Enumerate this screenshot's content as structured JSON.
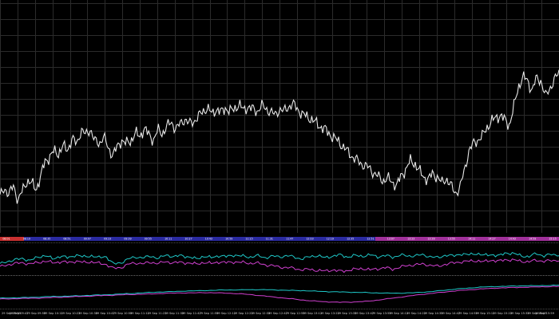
{
  "chart_data": {
    "type": "line",
    "title": "",
    "xlabel": "",
    "ylabel": "",
    "grid": true,
    "background": "#000000",
    "grid_color": "#2b2b2b",
    "price_series": {
      "name": "",
      "color": "#e8e8e8",
      "level_scale": [
        0,
        100
      ],
      "values": [
        15,
        22,
        17,
        24,
        12,
        20,
        28,
        26,
        21,
        31,
        44,
        47,
        52,
        50,
        56,
        53,
        62,
        58,
        69,
        65,
        70,
        60,
        58,
        64,
        54,
        49,
        55,
        61,
        58,
        60,
        67,
        63,
        71,
        65,
        61,
        69,
        66,
        72,
        75,
        70,
        74,
        78,
        74,
        76,
        80,
        84,
        87,
        82,
        86,
        83,
        87,
        84,
        86,
        90,
        85,
        88,
        86,
        84,
        89,
        86,
        84,
        81,
        86,
        84,
        88,
        90,
        86,
        82,
        80,
        78,
        75,
        72,
        70,
        66,
        63,
        60,
        56,
        52,
        48,
        45,
        42,
        40,
        38,
        34,
        31,
        28,
        30,
        27,
        24,
        32,
        37,
        44,
        42,
        36,
        31,
        29,
        34,
        31,
        26,
        30,
        24,
        18,
        22,
        36,
        52,
        58,
        61,
        64,
        71,
        76,
        79,
        81,
        77,
        73,
        88,
        104,
        112,
        109,
        101,
        111,
        109,
        96,
        103,
        110,
        115
      ]
    },
    "indicator1_series": [
      {
        "name": "",
        "color": "#1ec8c8",
        "values": [
          30,
          40,
          45,
          50,
          42,
          55,
          60,
          48,
          58,
          52,
          62,
          55,
          60,
          52,
          58,
          30,
          35,
          48,
          55,
          52,
          58,
          50,
          62,
          56,
          60,
          55,
          48,
          58,
          52,
          60,
          56,
          62,
          58,
          54,
          60,
          52,
          58,
          55,
          60,
          54,
          48,
          56,
          60,
          52,
          58,
          62,
          55,
          60,
          58,
          62,
          56,
          60,
          54,
          62,
          58,
          60,
          62,
          56,
          52,
          62,
          58,
          66,
          62,
          68,
          60,
          64,
          58,
          70,
          66,
          60,
          55,
          68,
          58,
          64,
          62
        ]
      },
      {
        "name": "",
        "color": "#d040d0",
        "values": [
          20,
          28,
          32,
          35,
          30,
          36,
          40,
          35,
          38,
          36,
          40,
          36,
          38,
          33,
          30,
          15,
          18,
          30,
          34,
          32,
          36,
          33,
          38,
          35,
          36,
          34,
          30,
          36,
          32,
          38,
          35,
          38,
          36,
          33,
          34,
          28,
          25,
          20,
          18,
          15,
          10,
          12,
          8,
          6,
          10,
          5,
          8,
          12,
          15,
          10,
          14,
          18,
          12,
          20,
          25,
          28,
          30,
          26,
          22,
          30,
          34,
          38,
          40,
          42,
          38,
          44,
          40,
          46,
          44,
          40,
          38,
          44,
          40,
          42,
          44
        ]
      }
    ],
    "indicator2_series": [
      {
        "name": "",
        "color": "#1ec8c8",
        "values": [
          30,
          31,
          32,
          33,
          35,
          36,
          37,
          38,
          40,
          41,
          43,
          45,
          47,
          49,
          51,
          52,
          54,
          55,
          56,
          57,
          58,
          58,
          59,
          59,
          58,
          57,
          56,
          55,
          53,
          52,
          51,
          50,
          49,
          48,
          47,
          47,
          48,
          50,
          53,
          57,
          61,
          64,
          67,
          69,
          70,
          71,
          72,
          72,
          73,
          74
        ]
      },
      {
        "name": "",
        "color": "#d040d0",
        "values": [
          27,
          28,
          29,
          30,
          31,
          33,
          34,
          36,
          37,
          39,
          40,
          42,
          43,
          44,
          46,
          47,
          48,
          48,
          49,
          48,
          47,
          45,
          42,
          38,
          34,
          30,
          26,
          22,
          19,
          17,
          16,
          17,
          19,
          23,
          28,
          33,
          38,
          43,
          47,
          51,
          55,
          58,
          61,
          63,
          65,
          66,
          67,
          68,
          69,
          70
        ]
      }
    ],
    "band": {
      "segment_colors": [
        "#c83030",
        "#2a2aa0",
        "#a0309a"
      ],
      "labels": [
        "08:01",
        "08:19",
        "08:35",
        "08:51",
        "09:07",
        "09:23",
        "09:39",
        "09:55",
        "10:11",
        "10:27",
        "10:43",
        "10:59",
        "11:15",
        "11:31",
        "11:47",
        "12:03",
        "12:19",
        "12:35",
        "12:51",
        "13:07",
        "13:23",
        "13:39",
        "13:55",
        "14:11",
        "14:27",
        "14:43",
        "14:59",
        "15:15"
      ]
    },
    "time_axis_labels": [
      "29 Sep 09:35",
      "29 Sep 09:47",
      "29 Sep 09:59",
      "29 Sep 10:11",
      "29 Sep 10:23",
      "29 Sep 10:35",
      "29 Sep 10:47",
      "29 Sep 10:59",
      "29 Sep 11:11",
      "29 Sep 11:23",
      "29 Sep 11:35",
      "29 Sep 11:47",
      "29 Sep 11:59",
      "29 Sep 12:11",
      "29 Sep 12:23",
      "29 Sep 12:35",
      "29 Sep 12:47",
      "29 Sep 12:59",
      "29 Sep 13:11",
      "29 Sep 13:23",
      "29 Sep 13:35",
      "29 Sep 13:47",
      "29 Sep 13:59",
      "29 Sep 14:11",
      "29 Sep 14:23",
      "29 Sep 14:35",
      "29 Sep 14:47",
      "29 Sep 14:59",
      "29 Sep 15:11",
      "29 Sep 15:23",
      "29 Sep 15:35",
      "29 Sep 15:47",
      "29 Sep 15:59"
    ]
  }
}
